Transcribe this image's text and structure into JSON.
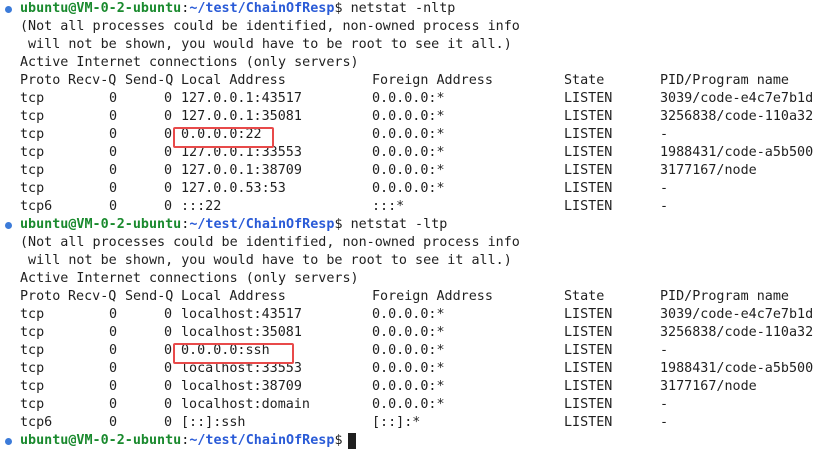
{
  "prompt1": {
    "user_host": "ubuntu@VM-0-2-ubuntu",
    "path": "~/test/ChainOfResp",
    "command": "netstat -nltp"
  },
  "prompt2": {
    "user_host": "ubuntu@VM-0-2-ubuntu",
    "path": "~/test/ChainOfResp",
    "command": "netstat -ltp"
  },
  "prompt3": {
    "user_host": "ubuntu@VM-0-2-ubuntu",
    "path": "~/test/ChainOfResp",
    "command": ""
  },
  "notice": {
    "line1": "(Not all processes could be identified, non-owned process info",
    "line2": " will not be shown, you would have to be root to see it all.)",
    "line3": "Active Internet connections (only servers)"
  },
  "header": {
    "proto": "Proto",
    "recvq": "Recv-Q",
    "sendq": "Send-Q",
    "local": "Local Address",
    "foreign": "Foreign Address",
    "state": "State",
    "pid": "PID/Program name"
  },
  "table1": [
    {
      "proto": "tcp",
      "recv": "0",
      "send": "0",
      "local": "127.0.0.1:43517",
      "foreign": "0.0.0.0:*",
      "state": "LISTEN",
      "pid": "3039/code-e4c7e7b1d"
    },
    {
      "proto": "tcp",
      "recv": "0",
      "send": "0",
      "local": "127.0.0.1:35081",
      "foreign": "0.0.0.0:*",
      "state": "LISTEN",
      "pid": "3256838/code-110a32"
    },
    {
      "proto": "tcp",
      "recv": "0",
      "send": "0",
      "local": "0.0.0.0:22",
      "foreign": "0.0.0.0:*",
      "state": "LISTEN",
      "pid": "-"
    },
    {
      "proto": "tcp",
      "recv": "0",
      "send": "0",
      "local": "127.0.0.1:33553",
      "foreign": "0.0.0.0:*",
      "state": "LISTEN",
      "pid": "1988431/code-a5b500"
    },
    {
      "proto": "tcp",
      "recv": "0",
      "send": "0",
      "local": "127.0.0.1:38709",
      "foreign": "0.0.0.0:*",
      "state": "LISTEN",
      "pid": "3177167/node"
    },
    {
      "proto": "tcp",
      "recv": "0",
      "send": "0",
      "local": "127.0.0.53:53",
      "foreign": "0.0.0.0:*",
      "state": "LISTEN",
      "pid": "-"
    },
    {
      "proto": "tcp6",
      "recv": "0",
      "send": "0",
      "local": ":::22",
      "foreign": ":::*",
      "state": "LISTEN",
      "pid": "-"
    }
  ],
  "table2": [
    {
      "proto": "tcp",
      "recv": "0",
      "send": "0",
      "local": "localhost:43517",
      "foreign": "0.0.0.0:*",
      "state": "LISTEN",
      "pid": "3039/code-e4c7e7b1d"
    },
    {
      "proto": "tcp",
      "recv": "0",
      "send": "0",
      "local": "localhost:35081",
      "foreign": "0.0.0.0:*",
      "state": "LISTEN",
      "pid": "3256838/code-110a32"
    },
    {
      "proto": "tcp",
      "recv": "0",
      "send": "0",
      "local": "0.0.0.0:ssh",
      "foreign": "0.0.0.0:*",
      "state": "LISTEN",
      "pid": "-"
    },
    {
      "proto": "tcp",
      "recv": "0",
      "send": "0",
      "local": "localhost:33553",
      "foreign": "0.0.0.0:*",
      "state": "LISTEN",
      "pid": "1988431/code-a5b500"
    },
    {
      "proto": "tcp",
      "recv": "0",
      "send": "0",
      "local": "localhost:38709",
      "foreign": "0.0.0.0:*",
      "state": "LISTEN",
      "pid": "3177167/node"
    },
    {
      "proto": "tcp",
      "recv": "0",
      "send": "0",
      "local": "localhost:domain",
      "foreign": "0.0.0.0:*",
      "state": "LISTEN",
      "pid": "-"
    },
    {
      "proto": "tcp6",
      "recv": "0",
      "send": "0",
      "local": "[::]:ssh",
      "foreign": "[::]:*",
      "state": "LISTEN",
      "pid": "-"
    }
  ],
  "colors": {
    "user": "#1a8a2e",
    "path": "#2a5bd7",
    "highlight": "#e84a4a",
    "marker": "#3c7bd9"
  },
  "icons": {
    "prompt_marker": "circle-dot-icon",
    "cursor": "block-cursor"
  }
}
